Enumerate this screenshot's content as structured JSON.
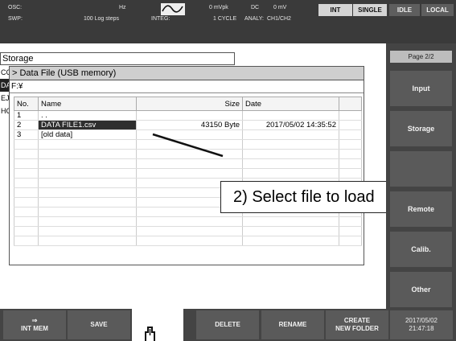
{
  "status": {
    "osc_label": "OSC:",
    "osc_freq_unit": "Hz",
    "osc_ampl": "0 mVpk",
    "osc_dc": "DC",
    "osc_offset": "0 mV",
    "swp_label": "SWP:",
    "swp_mode": "100 Log steps",
    "integ_label": "INTEG:",
    "integ_value": "1 CYCLE",
    "analy_label": "ANALY:",
    "analy_value": "CH1/CH2",
    "int": "INT",
    "single": "SINGLE",
    "idle": "IDLE",
    "local": "LOCAL"
  },
  "storage": {
    "title": "Storage",
    "left_tabs": [
      "CC",
      "DA",
      "EJ",
      "HC"
    ],
    "dialog_title": "> Data File (USB memory)",
    "path": "F:¥",
    "columns": {
      "no": "No.",
      "name": "Name",
      "size": "Size",
      "date": "Date"
    },
    "files": [
      {
        "no": "1",
        "name": ". .",
        "size": "",
        "date": ""
      },
      {
        "no": "2",
        "name": "DATA FILE1.csv",
        "size": "43150 Byte",
        "date": "2017/05/02 14:35:52"
      },
      {
        "no": "3",
        "name": "[old data]",
        "size": "",
        "date": ""
      }
    ],
    "selected_no": "2"
  },
  "callout": {
    "text": "2) Select file to load"
  },
  "softkeys_right": {
    "page": "Page 2/2",
    "input": "Input",
    "storage": "Storage",
    "remote": "Remote",
    "calib": "Calib.",
    "other": "Other"
  },
  "softkeys_bottom": {
    "int_mem_arrow": "⇒",
    "int_mem": "INT MEM",
    "save": "SAVE",
    "delete": "DELETE",
    "rename": "RENAME",
    "create_line1": "CREATE",
    "create_line2": "NEW FOLDER"
  },
  "datetime": {
    "date": "2017/05/02",
    "time": "21:47:18"
  }
}
